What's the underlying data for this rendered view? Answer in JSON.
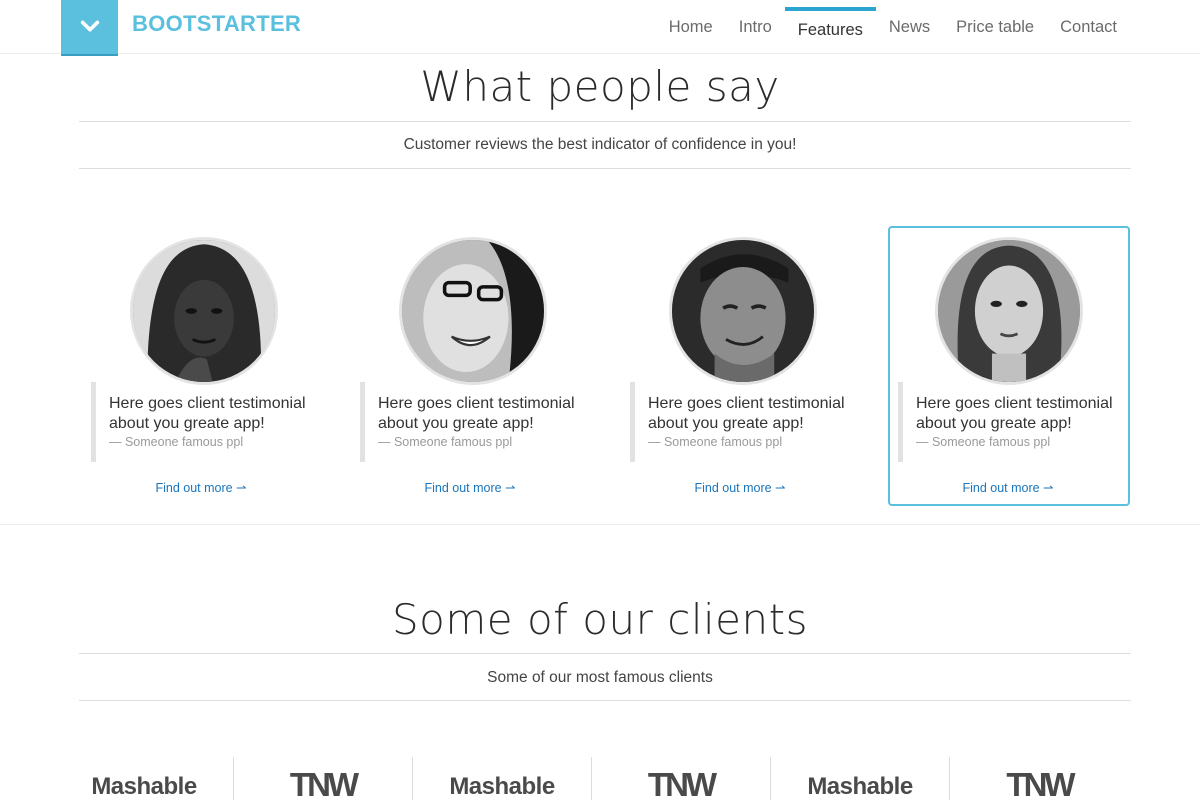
{
  "brand": {
    "name": "BOOTSTARTER",
    "icon": "chevron-down-icon",
    "color": "#5bc0de"
  },
  "nav": {
    "items": [
      {
        "label": "Home"
      },
      {
        "label": "Intro"
      },
      {
        "label": "Features",
        "active": true
      },
      {
        "label": "News"
      },
      {
        "label": "Price table"
      },
      {
        "label": "Contact"
      }
    ],
    "accent": "#2aa5cf"
  },
  "testimonials": {
    "title": "What people say",
    "subtitle": "Customer reviews the best indicator of confidence in you!",
    "cards": [
      {
        "quote": "Here goes client testimonial about you greate app!",
        "author": "— Someone famous ppl",
        "link": "Find out more ⇀",
        "highlighted": false
      },
      {
        "quote": "Here goes client testimonial about you greate app!",
        "author": "— Someone famous ppl",
        "link": "Find out more ⇀",
        "highlighted": false
      },
      {
        "quote": "Here goes client testimonial about you greate app!",
        "author": "— Someone famous ppl",
        "link": "Find out more ⇀",
        "highlighted": false
      },
      {
        "quote": "Here goes client testimonial about you greate app!",
        "author": "— Someone famous ppl",
        "link": "Find out more ⇀",
        "highlighted": true
      }
    ]
  },
  "clients": {
    "title": "Some of our clients",
    "subtitle": "Some of our most famous clients",
    "logos": [
      {
        "name": "Mashable"
      },
      {
        "name": "TNW"
      },
      {
        "name": "Mashable"
      },
      {
        "name": "TNW"
      },
      {
        "name": "Mashable"
      },
      {
        "name": "TNW"
      }
    ]
  }
}
